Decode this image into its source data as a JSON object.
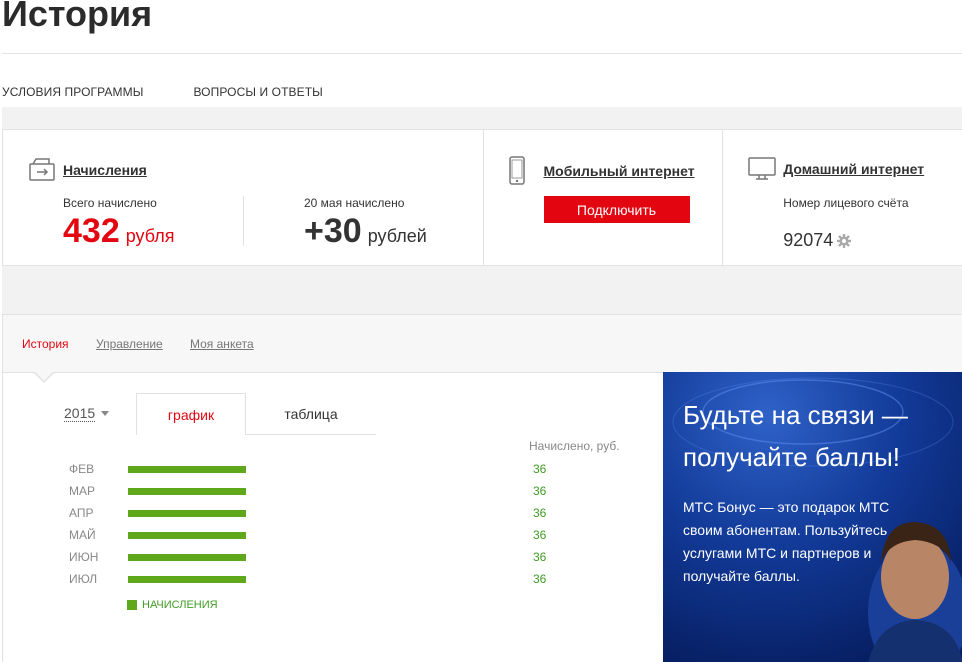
{
  "header": {
    "title": "История"
  },
  "top_nav": {
    "items": [
      {
        "label": "УСЛОВИЯ ПРОГРАММЫ"
      },
      {
        "label": "ВОПРОСЫ И ОТВЕТЫ"
      }
    ]
  },
  "cards": {
    "accruals": {
      "link": "Начисления",
      "total_label": "Всего начислено",
      "total_value": "432",
      "total_unit": "рубля",
      "recent_label": "20 мая начислено",
      "recent_value": "+30",
      "recent_unit": "рублей"
    },
    "mobile": {
      "link": "Мобильный интернет",
      "button": "Подключить"
    },
    "home": {
      "link": "Домашний интернет",
      "account_label": "Номер лицевого счёта",
      "account_value": "92074"
    }
  },
  "section_tabs": {
    "items": [
      {
        "label": "История"
      },
      {
        "label": "Управление"
      },
      {
        "label": "Моя анкета"
      }
    ],
    "active": "История"
  },
  "history": {
    "year": "2015",
    "view_tabs": {
      "graph": "график",
      "table": "таблица"
    },
    "column_header": "Начислено, руб."
  },
  "chart_data": {
    "type": "bar",
    "orientation": "horizontal",
    "categories": [
      "ФЕВ",
      "МАР",
      "АПР",
      "МАЙ",
      "ИЮН",
      "ИЮЛ"
    ],
    "series": [
      {
        "name": "НАЧИСЛЕНИЯ",
        "values": [
          36,
          36,
          36,
          36,
          36,
          36
        ],
        "color": "#5fa81b"
      }
    ],
    "value_labels": [
      "36",
      "36",
      "36",
      "36",
      "36",
      "36"
    ],
    "value_label_color": "#3f9c23",
    "max_value": 36,
    "legend": "bottom-left"
  },
  "promo": {
    "headline": "Будьте на связи — получайте баллы!",
    "text": "МТС Бонус — это подарок МТС своим абонентам. Пользуйтесь услугами МТС и партнеров и получайте баллы.",
    "background": "#0b2a7a"
  },
  "colors": {
    "accent": "#e30611",
    "bar": "#5fa81b",
    "text": "#333333"
  }
}
